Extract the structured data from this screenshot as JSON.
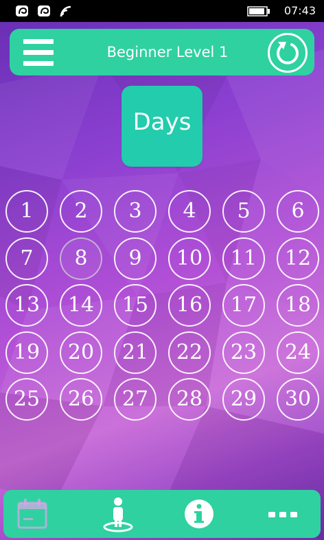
{
  "status_bar": {
    "time": "07:43",
    "icons": [
      "notification-icon",
      "notification-icon",
      "wifi-icon",
      "battery-icon"
    ]
  },
  "header": {
    "title": "Beginner Level 1",
    "menu_icon": "hamburger-menu-icon",
    "refresh_icon": "refresh-icon"
  },
  "days_label": "Days",
  "days": [
    "1",
    "2",
    "3",
    "4",
    "5",
    "6",
    "7",
    "8",
    "9",
    "10",
    "11",
    "12",
    "13",
    "14",
    "15",
    "16",
    "17",
    "18",
    "19",
    "20",
    "21",
    "22",
    "23",
    "24",
    "25",
    "26",
    "27",
    "28",
    "29",
    "30"
  ],
  "current_day": "8",
  "bottom_bar": {
    "icons": [
      "calendar-icon",
      "user-position-icon",
      "info-icon",
      "more-icon"
    ]
  },
  "colors": {
    "accent": "#2fd1a0",
    "tile": "#22ccac",
    "background_top": "#6a2fb5",
    "background_mid": "#c96ad8"
  }
}
